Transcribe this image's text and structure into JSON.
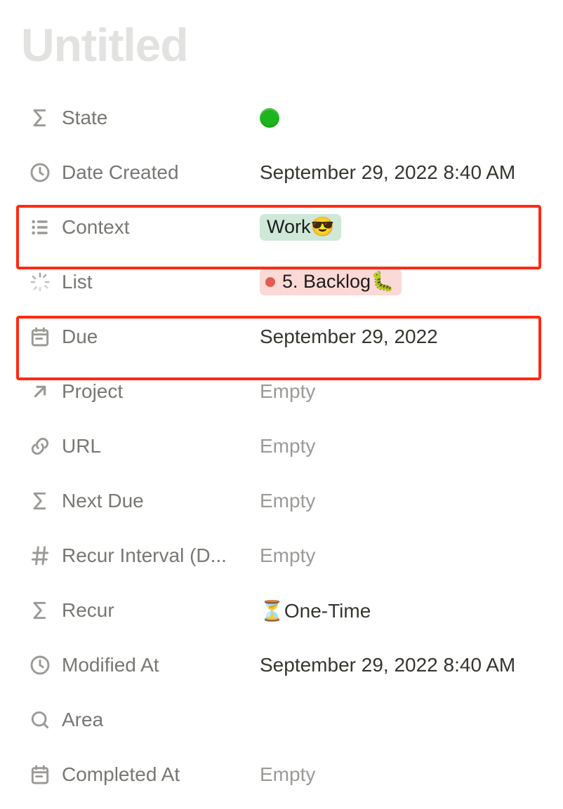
{
  "title": "Untitled",
  "properties": {
    "state": {
      "label": "State",
      "value": "🟢"
    },
    "date_created": {
      "label": "Date Created",
      "value": "September 29, 2022 8:40 AM"
    },
    "context": {
      "label": "Context",
      "tag": "Work😎"
    },
    "list": {
      "label": "List",
      "tag": "5. Backlog🐛"
    },
    "due": {
      "label": "Due",
      "value": "September 29, 2022"
    },
    "project": {
      "label": "Project",
      "value": "Empty",
      "empty": true
    },
    "url": {
      "label": "URL",
      "value": "Empty",
      "empty": true
    },
    "next_due": {
      "label": "Next Due",
      "value": "Empty",
      "empty": true
    },
    "recur_interval": {
      "label": "Recur Interval (D...",
      "value": "Empty",
      "empty": true
    },
    "recur": {
      "label": "Recur",
      "value": "⏳One-Time"
    },
    "modified_at": {
      "label": "Modified At",
      "value": "September 29, 2022 8:40 AM"
    },
    "area": {
      "label": "Area",
      "value": ""
    },
    "completed_at": {
      "label": "Completed At",
      "value": "Empty",
      "empty": true
    }
  }
}
